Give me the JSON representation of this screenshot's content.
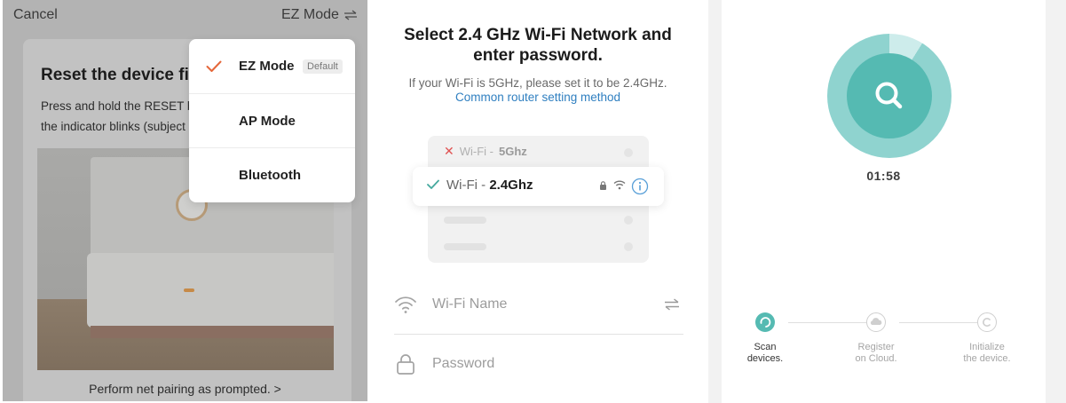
{
  "pairing_mode": {
    "header": {
      "cancel_label": "Cancel",
      "mode_label": "EZ Mode"
    },
    "reset_title": "Reset the device fi",
    "reset_lines": [
      "Press and hold the RESET bu",
      "the indicator blinks (subject"
    ],
    "bottom_link": "Perform net pairing as prompted. >",
    "menu": {
      "items": [
        {
          "label": "EZ Mode",
          "badge": "Default",
          "selected": true
        },
        {
          "label": "AP Mode",
          "selected": false
        },
        {
          "label": "Bluetooth",
          "selected": false
        }
      ]
    },
    "colors": {
      "check": "#e5673a",
      "overlay": "#b3b3b3"
    }
  },
  "wifi_setup": {
    "title_line1": "Select 2.4 GHz Wi-Fi Network and",
    "title_line2": "enter password.",
    "hint": "If your Wi-Fi is 5GHz, please set it to be 2.4GHz.",
    "link": "Common router setting method",
    "bad_network": {
      "prefix": "Wi-Fi -",
      "band": "5Ghz",
      "icon": "x-icon"
    },
    "good_network": {
      "prefix": "Wi-Fi -",
      "band": "2.4Ghz",
      "icon": "check-icon"
    },
    "wifi_name_placeholder": "Wi-Fi Name",
    "password_placeholder": "Password",
    "colors": {
      "link": "#2f7fc0",
      "check": "#45a99e",
      "info": "#5aa0d8",
      "error": "#e05252"
    }
  },
  "scan": {
    "timer": "01:58",
    "progress": 0.09,
    "steps": [
      {
        "line1": "Scan",
        "line2": "devices.",
        "state": "active",
        "icon": "spinner-icon"
      },
      {
        "line1": "Register",
        "line2": "on Cloud.",
        "state": "pending",
        "icon": "cloud-icon"
      },
      {
        "line1": "Initialize",
        "line2": "the device.",
        "state": "pending",
        "icon": "init-icon"
      }
    ],
    "colors": {
      "primary": "#55bab2",
      "ring": "#8fd3cf",
      "ring_light": "#cdeceb"
    }
  }
}
